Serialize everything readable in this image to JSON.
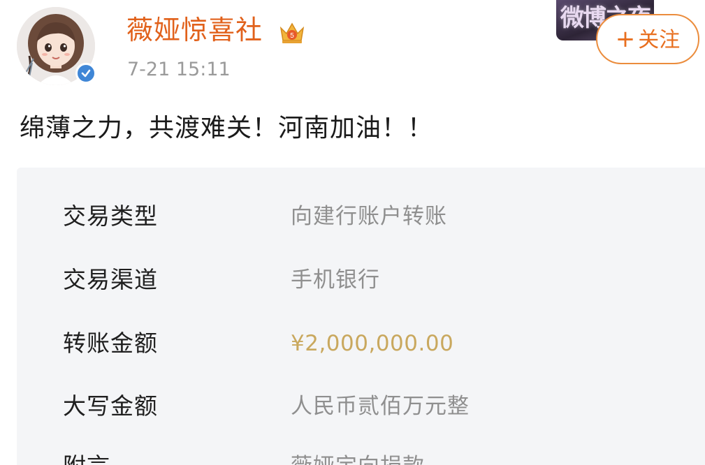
{
  "header": {
    "username": "薇娅惊喜社",
    "timestamp": "7-21 15:11",
    "follow_label": "关注",
    "follow_plus": "+",
    "avatar_icon": "cartoon-girl-avatar",
    "verified_icon": "verified-checkmark-icon",
    "crown_icon": "vip-crown-icon",
    "event_logo_text": "微博之夜"
  },
  "post": {
    "text": "绵薄之力，共渡难关！河南加油！！"
  },
  "receipt": {
    "rows": [
      {
        "label": "交易类型",
        "value": "向建行账户转账"
      },
      {
        "label": "交易渠道",
        "value": "手机银行"
      },
      {
        "label": "转账金额",
        "value": "¥2,000,000.00"
      },
      {
        "label": "大写金额",
        "value": "人民币贰佰万元整"
      },
      {
        "label": "附言",
        "value": "薇娅定向捐款"
      }
    ]
  },
  "colors": {
    "username": "#e1611b",
    "follow_border": "#eb8c3c",
    "amount": "#c9a85e",
    "verified": "#3f86d6",
    "card_bg": "#f4f5f7"
  }
}
